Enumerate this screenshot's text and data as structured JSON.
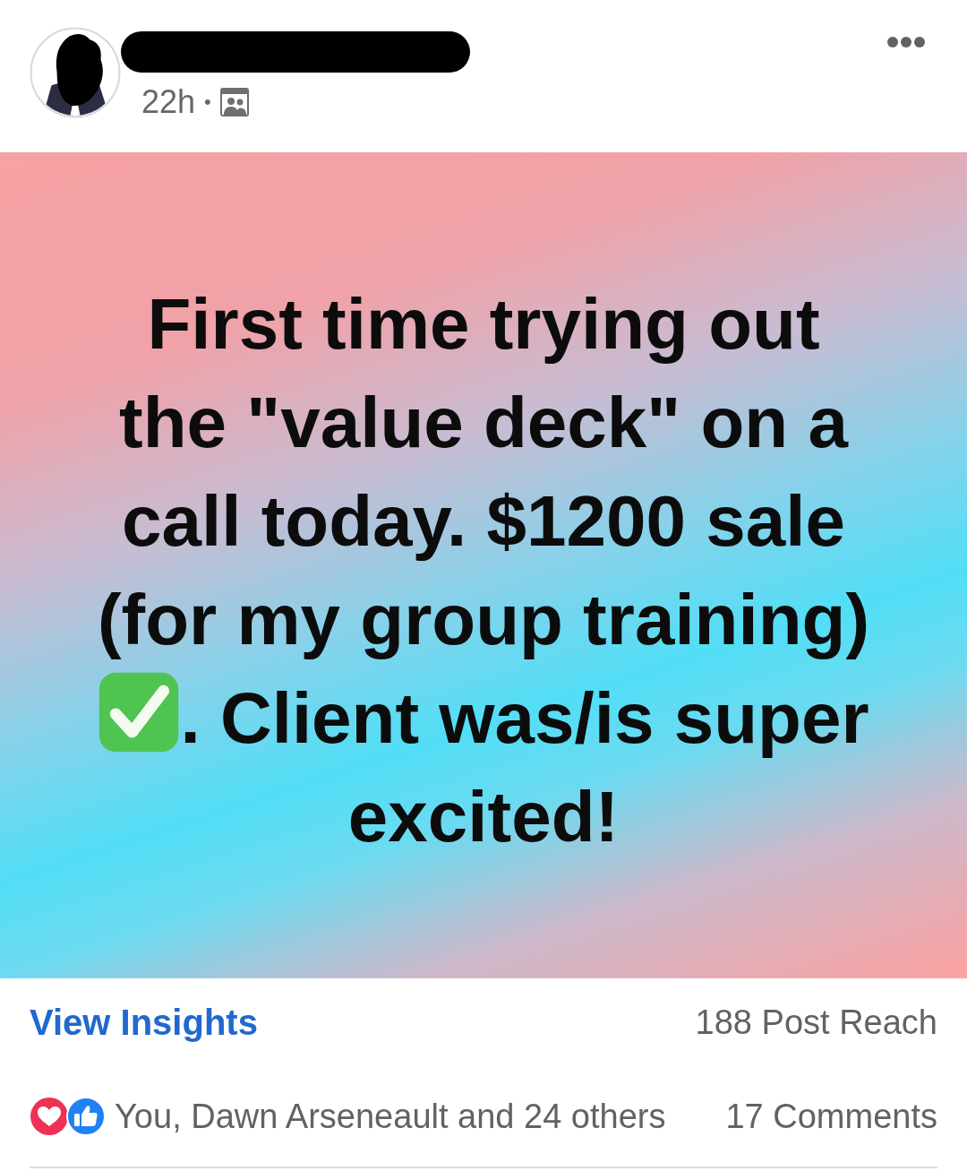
{
  "post": {
    "author": {
      "redacted": true
    },
    "time": "22h",
    "separator": "•"
  },
  "body": [
    {
      "kind": "text",
      "text": "First time trying out the \"value deck\" on a call today. $1200 sale (for my group training)"
    },
    {
      "kind": "emoji"
    },
    {
      "kind": "text",
      "text": ". Client was/is super excited!"
    }
  ],
  "insights": {
    "link": "View Insights",
    "reach": "188 Post Reach"
  },
  "engagement": {
    "reactions": "You, Dawn Arseneault and 24 others",
    "comments": "17 Comments"
  }
}
